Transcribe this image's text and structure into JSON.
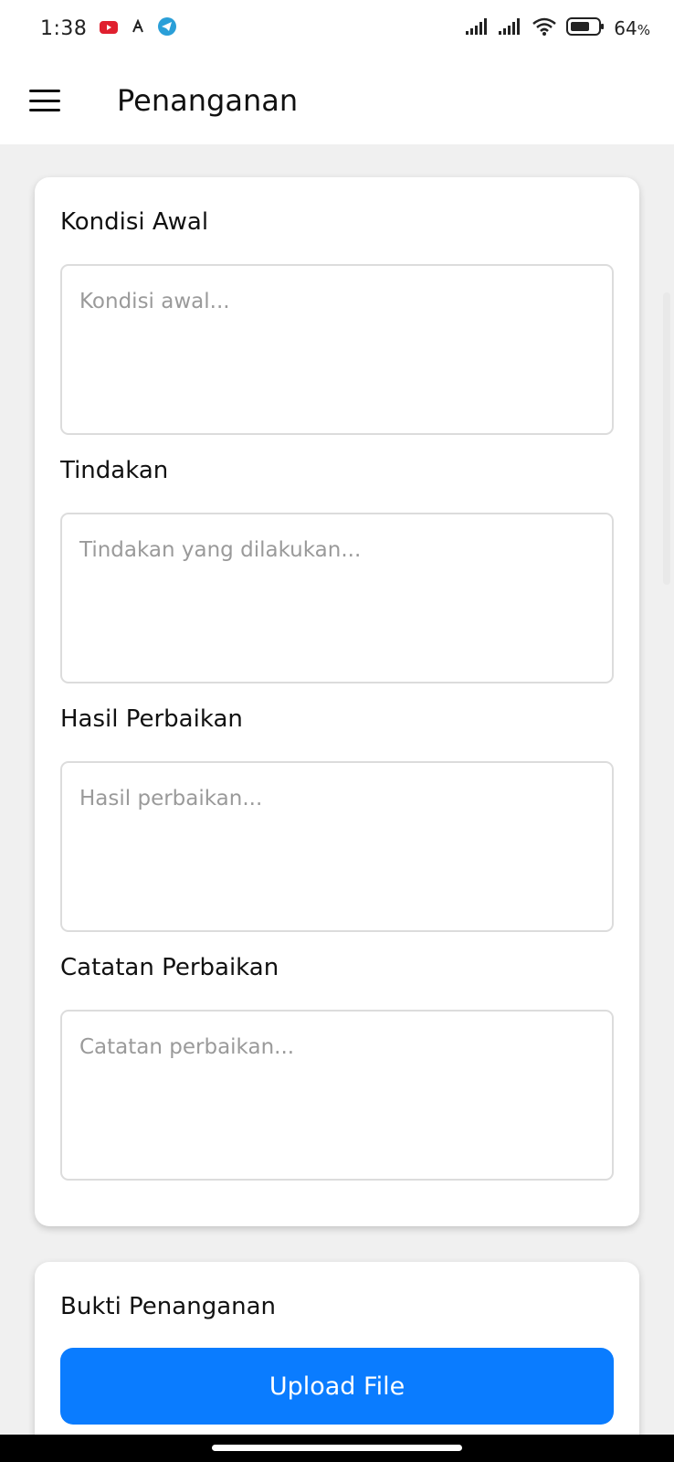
{
  "status_bar": {
    "time": "1:38",
    "battery": "64",
    "battery_unit": "%",
    "icons": [
      "youtube-icon",
      "app-notification-icon",
      "telegram-icon",
      "signal-icon",
      "signal-icon",
      "wifi-icon",
      "battery-icon"
    ]
  },
  "app_bar": {
    "title": "Penanganan"
  },
  "form": {
    "kondisi_awal": {
      "label": "Kondisi Awal",
      "placeholder": "Kondisi awal..."
    },
    "tindakan": {
      "label": "Tindakan",
      "placeholder": "Tindakan yang dilakukan..."
    },
    "hasil_perbaikan": {
      "label": "Hasil Perbaikan",
      "placeholder": "Hasil perbaikan..."
    },
    "catatan_perbaikan": {
      "label": "Catatan Perbaikan",
      "placeholder": "Catatan perbaikan..."
    }
  },
  "bukti": {
    "label": "Bukti Penanganan",
    "upload_label": "Upload File"
  },
  "colors": {
    "accent": "#0a7cff",
    "background": "#f0f0f0",
    "card": "#ffffff"
  }
}
